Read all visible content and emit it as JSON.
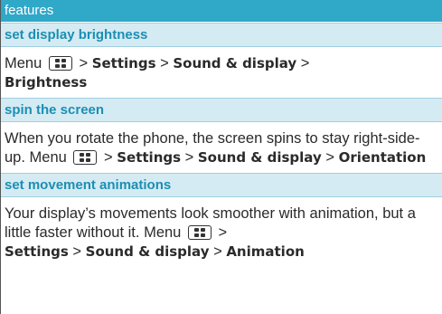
{
  "header": {
    "title": "features"
  },
  "sections": [
    {
      "title": "set display brightness",
      "parts": [
        "Menu",
        ">",
        "Settings",
        ">",
        "Sound & display",
        ">",
        "Brightness"
      ]
    },
    {
      "title": "spin the screen",
      "intro": "When you rotate the phone, the screen spins to stay right-side-up.",
      "parts": [
        "Menu",
        ">",
        "Settings",
        ">",
        "Sound & display",
        ">",
        "Orientation"
      ]
    },
    {
      "title": "set movement animations",
      "intro": "Your display’s movements look smoother with animation, but a little faster without it.",
      "parts": [
        "Menu",
        ">",
        "Settings",
        ">",
        "Sound & display",
        ">",
        "Animation"
      ]
    }
  ],
  "icons": {
    "menu_key": "menu-key-icon"
  },
  "colors": {
    "header_bg": "#30a8c8",
    "subheader_bg": "#d5ebf3",
    "subheader_text": "#1b8fb3"
  }
}
